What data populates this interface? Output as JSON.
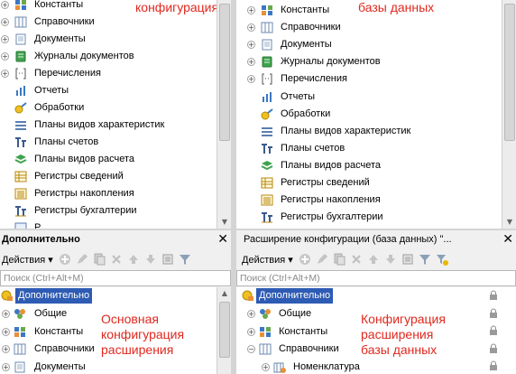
{
  "top_left": {
    "overlay": "конфигурация",
    "items": [
      {
        "label": "Константы",
        "icon": "constants-icon",
        "expand": "+"
      },
      {
        "label": "Справочники",
        "icon": "catalogs-icon",
        "expand": "+"
      },
      {
        "label": "Документы",
        "icon": "documents-icon",
        "expand": "+"
      },
      {
        "label": "Журналы документов",
        "icon": "document-journals-icon",
        "expand": "+"
      },
      {
        "label": "Перечисления",
        "icon": "enumerations-icon",
        "expand": "+"
      },
      {
        "label": "Отчеты",
        "icon": "reports-icon",
        "expand": ""
      },
      {
        "label": "Обработки",
        "icon": "data-processors-icon",
        "expand": ""
      },
      {
        "label": "Планы видов характеристик",
        "icon": "chart-of-characteristic-types-icon",
        "expand": ""
      },
      {
        "label": "Планы счетов",
        "icon": "chart-of-accounts-icon",
        "expand": ""
      },
      {
        "label": "Планы видов расчета",
        "icon": "chart-of-calculation-types-icon",
        "expand": ""
      },
      {
        "label": "Регистры сведений",
        "icon": "information-registers-icon",
        "expand": ""
      },
      {
        "label": "Регистры накопления",
        "icon": "accumulation-registers-icon",
        "expand": ""
      },
      {
        "label": "Регистры бухгалтерии",
        "icon": "accounting-registers-icon",
        "expand": ""
      },
      {
        "label": "Р...",
        "icon": "calculation-registers-icon",
        "expand": ""
      }
    ]
  },
  "top_right": {
    "overlay": "базы данных",
    "items": [
      {
        "label": "Константы",
        "icon": "constants-icon",
        "expand": "+"
      },
      {
        "label": "Справочники",
        "icon": "catalogs-icon",
        "expand": "+"
      },
      {
        "label": "Документы",
        "icon": "documents-icon",
        "expand": "+"
      },
      {
        "label": "Журналы документов",
        "icon": "document-journals-icon",
        "expand": "+"
      },
      {
        "label": "Перечисления",
        "icon": "enumerations-icon",
        "expand": "+"
      },
      {
        "label": "Отчеты",
        "icon": "reports-icon",
        "expand": ""
      },
      {
        "label": "Обработки",
        "icon": "data-processors-icon",
        "expand": ""
      },
      {
        "label": "Планы видов характеристик",
        "icon": "chart-of-characteristic-types-icon",
        "expand": ""
      },
      {
        "label": "Планы счетов",
        "icon": "chart-of-accounts-icon",
        "expand": ""
      },
      {
        "label": "Планы видов расчета",
        "icon": "chart-of-calculation-types-icon",
        "expand": ""
      },
      {
        "label": "Регистры сведений",
        "icon": "information-registers-icon",
        "expand": ""
      },
      {
        "label": "Регистры накопления",
        "icon": "accumulation-registers-icon",
        "expand": ""
      },
      {
        "label": "Регистры бухгалтерии",
        "icon": "accounting-registers-icon",
        "expand": ""
      }
    ]
  },
  "bottom_left": {
    "title": "Дополнительно",
    "close": "✕",
    "actions_label": "Действия ▾",
    "search_placeholder": "Поиск (Ctrl+Alt+M)",
    "overlay": [
      "Основная",
      "конфигурация",
      "расширения"
    ],
    "root": "Дополнительно",
    "items": [
      {
        "label": "Общие",
        "icon": "common-icon",
        "expand": "+"
      },
      {
        "label": "Константы",
        "icon": "constants-icon",
        "expand": "+"
      },
      {
        "label": "Справочники",
        "icon": "catalogs-icon",
        "expand": "+"
      },
      {
        "label": "Документы",
        "icon": "documents-icon",
        "expand": "+"
      }
    ]
  },
  "bottom_right": {
    "title": "Расширение конфигурации (база данных) \"...",
    "close": "✕",
    "actions_label": "Действия ▾",
    "search_placeholder": "Поиск (Ctrl+Alt+M)",
    "overlay": [
      "Конфигурация",
      "расширения",
      "базы данных"
    ],
    "root": "Дополнительно",
    "items": [
      {
        "label": "Общие",
        "icon": "common-icon",
        "expand": "+"
      },
      {
        "label": "Константы",
        "icon": "constants-icon",
        "expand": "+"
      },
      {
        "label": "Справочники",
        "icon": "catalogs-icon",
        "expand": "−"
      },
      {
        "label": "Номенклатура",
        "icon": "catalog-item-icon",
        "expand": "+"
      }
    ]
  },
  "colors": {
    "overlay_text": "#e0281e",
    "selection": "#2e5bb3",
    "pane_background": "#ffffff",
    "chrome_background": "#f0f0f0"
  }
}
